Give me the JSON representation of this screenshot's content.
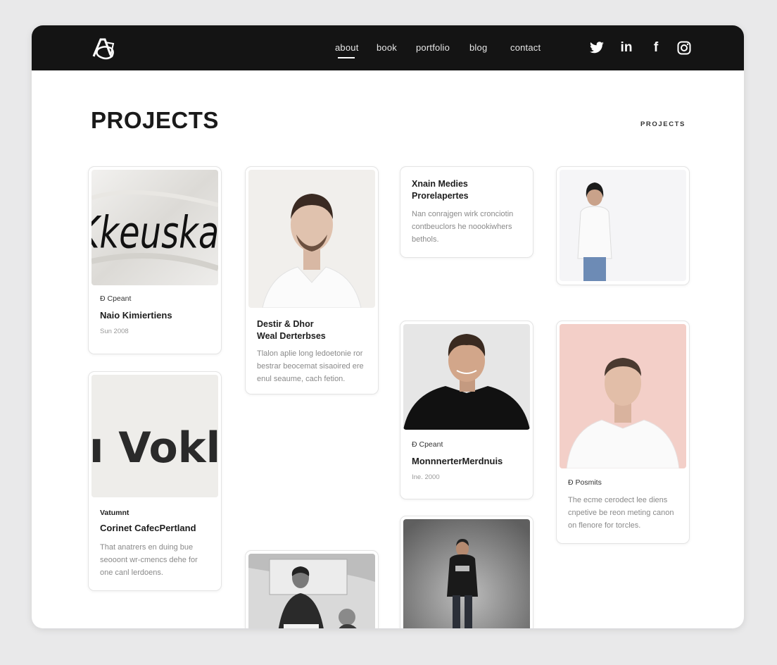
{
  "nav": {
    "links": [
      "about",
      "book",
      "portfolio",
      "blog",
      "contact"
    ],
    "active": "about",
    "social": [
      "twitter-icon",
      "linkedin-icon",
      "facebook-icon",
      "instagram-icon"
    ],
    "linkedin_text": "in",
    "facebook_text": "f"
  },
  "page": {
    "title": "PROJECTS",
    "breadcrumb": "PROJECTS"
  },
  "cards": {
    "c1": {
      "thumb_text": "Kkeuskat",
      "meta": "Ɖ Cpeant",
      "title": "Naio Kimiertiens",
      "date": "Sun 2008"
    },
    "c2": {
      "thumb_text": "ı Vokl",
      "meta": "Vatumnt",
      "title": "Corinet CafecPertland",
      "desc": "That anatrers en duing bue seooont wr-cmencs dehe for one canl lerdoens."
    },
    "c3": {
      "title": "Destir & Dhor\nWeal Derterbses",
      "desc": "Tlalon aplie long ledoetonie ror bestrar beocemat sisaoired ere enul seaume, cach fetion."
    },
    "c4": {},
    "c5": {
      "title": "Xnain Medies\nProrelapertes",
      "desc": "Nan conrajgen wirk cronciotin contbeuclors he noookiwhers bethols."
    },
    "c6": {
      "meta": "Ɖ Cpeant",
      "title": "MonnnerterMerdnuis",
      "date": "Ine. 2000"
    },
    "c7": {},
    "c8": {},
    "c9": {
      "meta": "Ɖ Posmits",
      "desc": "The ecme cerodect lee diens cnpetive be reon meting canon on flenore for torcles."
    }
  },
  "colors": {
    "navbar": "#141414",
    "page_bg": "#e9e9ea",
    "pink_thumb": "#f3cfc8"
  }
}
